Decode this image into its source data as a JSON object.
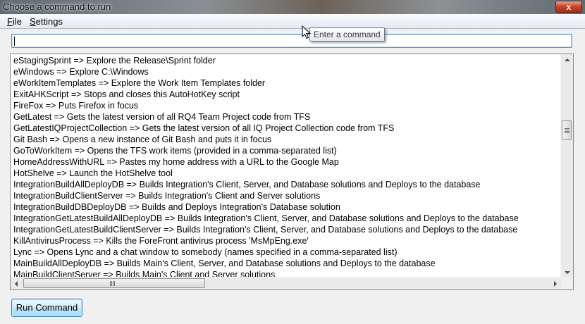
{
  "window": {
    "title": "Choose a command to run",
    "close_label": "x"
  },
  "menu": {
    "file": {
      "mnemonic": "F",
      "rest": "ile"
    },
    "settings": {
      "mnemonic": "S",
      "rest": "ettings"
    }
  },
  "command_input": {
    "value": "",
    "tooltip": "Enter a command"
  },
  "commands": [
    "eStagingSprint => Explore the Release\\Sprint folder",
    "eWindows => Explore C:\\Windows",
    "eWorkItemTemplates => Explore the Work Item Templates folder",
    "ExitAHKScript => Stops and closes this AutoHotKey script",
    "FireFox => Puts Firefox in focus",
    "GetLatest => Gets the latest version of all RQ4 Team Project code from TFS",
    "GetLatestIQProjectCollection => Gets the latest version of all IQ Project Collection code from TFS",
    "Git Bash => Opens a new instance of Git Bash and puts it in focus",
    "GoToWorkItem => Opens the TFS work items (provided in a comma-separated list)",
    "HomeAddressWithURL => Pastes my home address with a URL to the Google Map",
    "HotShelve => Launch the HotShelve tool",
    "IntegrationBuildAllDeployDB => Builds Integration's Client, Server, and Database solutions and Deploys to the database",
    "IntegrationBuildClientServer => Builds Integration's Client and Server solutions",
    "IntegrationBuildDBDeployDB => Builds and Deploys Integration's Database solution",
    "IntegrationGetLatestBuildAllDeployDB => Builds Integration's Client, Server, and Database solutions and Deploys to the database",
    "IntegrationGetLatestBuildClientServer => Builds Integration's Client, Server, and Database solutions and Deploys to the database",
    "KillAntivirusProcess => Kills the ForeFront antivirus process 'MsMpEng.exe'",
    "Lync => Opens Lync and a chat window to somebody (names specified in a comma-separated list)",
    "MainBuildAllDeployDB => Builds Main's Client, Server, and Database solutions and Deploys to the database",
    "MainBuildClientServer => Builds Main's Client and Server solutions"
  ],
  "run_button": {
    "label": "Run Command"
  }
}
